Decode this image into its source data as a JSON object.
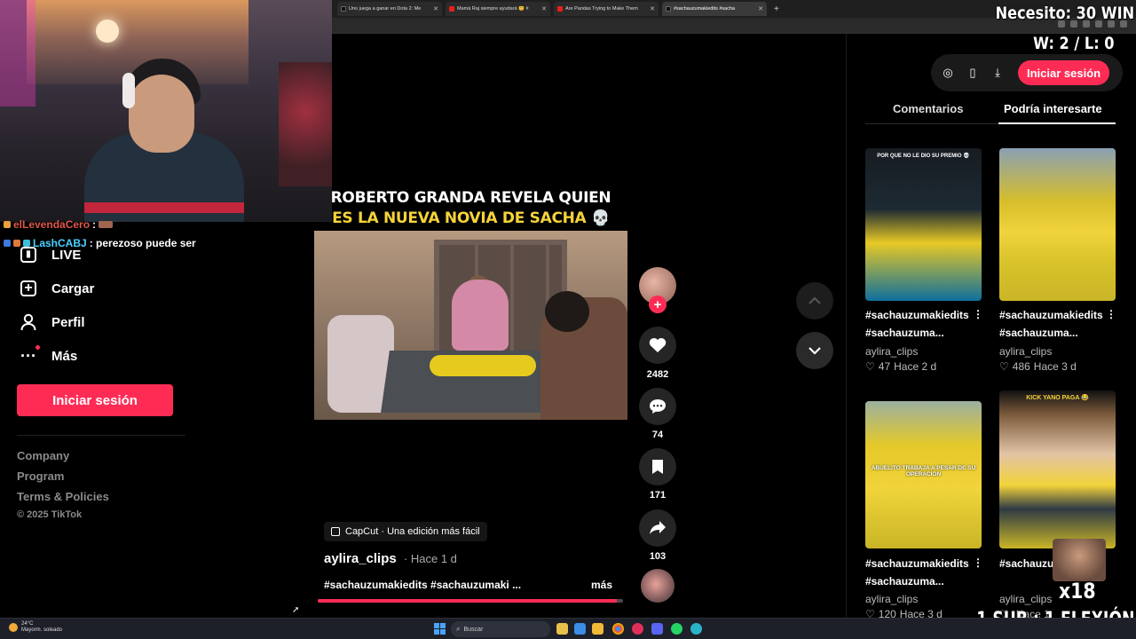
{
  "browser": {
    "tabs": [
      {
        "title": "Uno juega a ganar en Dota 2: Me",
        "color": "#111111",
        "active": false
      },
      {
        "title": "Mamá Raj siempre ayudará 😊 #",
        "color": "#e62117",
        "active": false
      },
      {
        "title": "Are Pandas Trying to Make Them",
        "color": "#e62117",
        "active": false
      },
      {
        "title": "#sachauzumakiedits #sacha",
        "color": "#111111",
        "active": true
      }
    ],
    "new_tab": "+"
  },
  "chat": {
    "messages": [
      {
        "user": "elLeyendaCero",
        "text": ":"
      },
      {
        "user": "LashCABJ",
        "text": ": perezoso puede ser"
      }
    ]
  },
  "sidebar": {
    "items": [
      {
        "label": "LIVE",
        "icon": "live-icon"
      },
      {
        "label": "Cargar",
        "icon": "upload-icon"
      },
      {
        "label": "Perfil",
        "icon": "profile-icon"
      },
      {
        "label": "Más",
        "icon": "more-icon"
      }
    ],
    "login": "Iniciar sesión",
    "footer": [
      "Company",
      "Program",
      "Terms & Policies"
    ],
    "copyright": "© 2025 TikTok"
  },
  "video": {
    "caption_line1": "ROBERTO GRANDA REVELA QUIEN",
    "caption_line2": "ES LA NUEVA NOVIA DE SACHA 💀",
    "capcut": "CapCut · Una edición más fácil",
    "author": "aylira_clips",
    "posted": "Hace 1 d",
    "description": "#sachauzumakiedits #sachauzumaki ...",
    "more": "más",
    "progress": 0.98,
    "likes": "2482",
    "comments": "74",
    "saves": "171",
    "shares": "103"
  },
  "right_panel": {
    "login": "Iniciar sesión",
    "tabs": [
      "Comentarios",
      "Podría interesarte"
    ],
    "cards": [
      {
        "title": "#sachauzumakiedits #sachauzuma...",
        "user": "aylira_clips",
        "likes": "47",
        "time": "Hace 2 d",
        "thumb_top": "POR QUE NO LE DIO SU PREMIO 💀"
      },
      {
        "title": "#sachauzumakiedits #sachauzuma...",
        "user": "aylira_clips",
        "likes": "486",
        "time": "Hace 3 d",
        "thumb_top": ""
      },
      {
        "title": "#sachauzumakiedits #sachauzuma...",
        "user": "aylira_clips",
        "likes": "120",
        "time": "Hace 3 d",
        "thumb_top": "ABUELITO TRABAJA A PESAR DE SU OPERACION"
      },
      {
        "title": "#sachauzumakiedits #sachauzuma...",
        "user": "aylira_clips",
        "likes": "",
        "time": "Hace 1",
        "thumb_top": "KICK YANO PAGA 😂"
      }
    ]
  },
  "overlays": {
    "goal": "Necesito: 30 WIN",
    "record": "W: 2 / L: 0",
    "multiplier": "x18",
    "sub_rule": "1 SUB : 1 FLEXIÓN"
  },
  "taskbar": {
    "temp": "24°C",
    "weather": "Mayorm. soleado",
    "search": "Buscar"
  },
  "colors": {
    "accent": "#fe2c55",
    "caption_yellow": "#f5d33a"
  }
}
